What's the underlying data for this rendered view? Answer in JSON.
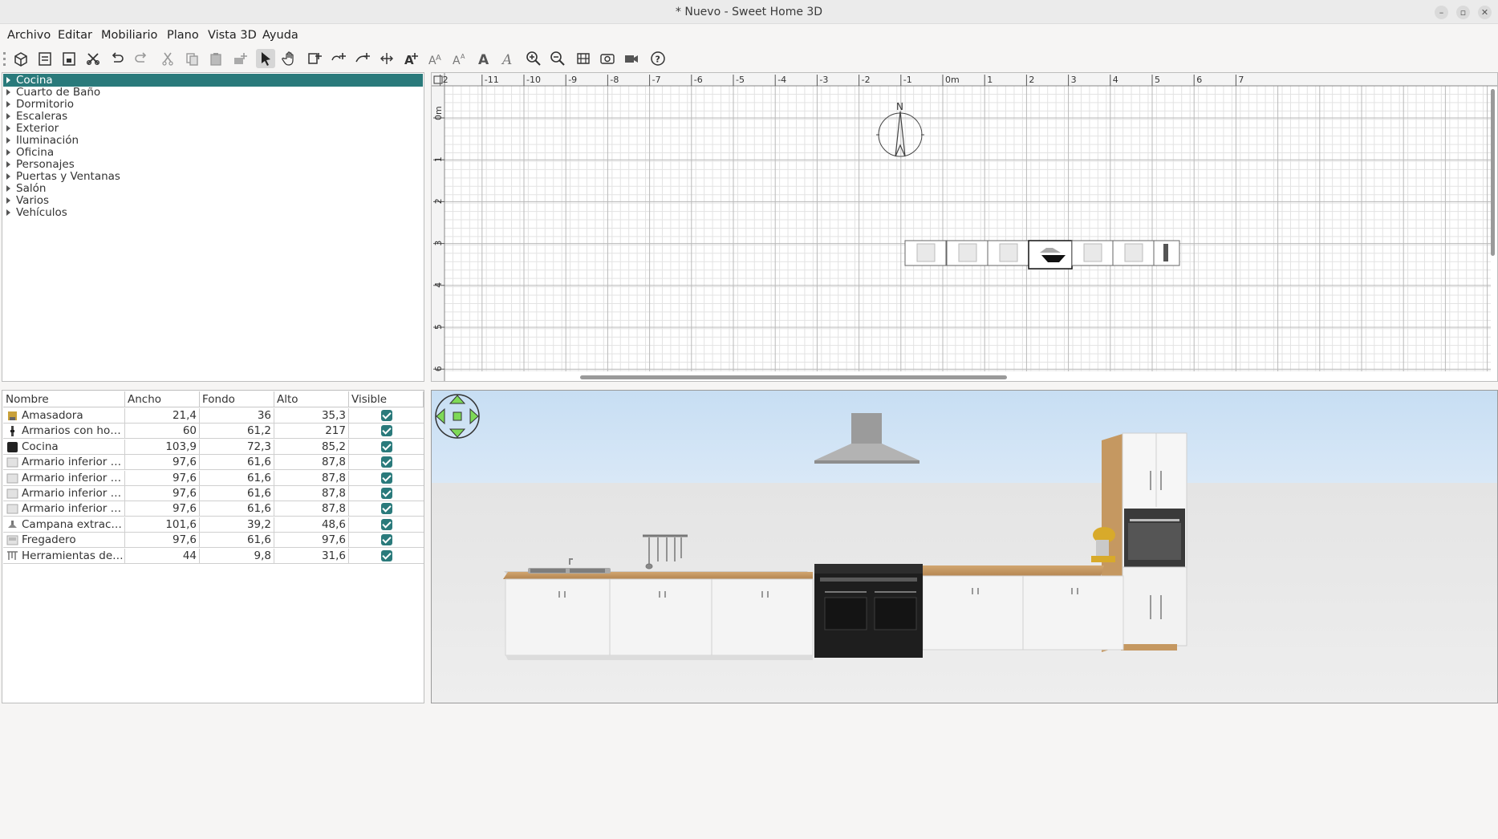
{
  "window": {
    "title": "* Nuevo - Sweet Home 3D",
    "controls": [
      "minimize-icon",
      "maximize-icon",
      "close-icon"
    ]
  },
  "menubar": {
    "items": [
      "Archivo",
      "Editar",
      "Mobiliario",
      "Plano",
      "Vista 3D",
      "Ayuda"
    ]
  },
  "toolbar": {
    "buttons": [
      "new-home-icon",
      "open-icon",
      "save-icon",
      "cut-wall-icon",
      "undo-icon",
      "redo-icon",
      "cut-icon",
      "copy-icon",
      "paste-icon",
      "add-furniture-icon",
      "select-mode-icon",
      "pan-mode-icon",
      "create-rooms-icon",
      "create-polylines-icon",
      "create-dimensions-icon",
      "create-walls-icon",
      "add-text-icon",
      "increase-text-size-icon",
      "decrease-text-size-icon",
      "bold-icon",
      "italic-icon",
      "zoom-in-icon",
      "zoom-out-icon",
      "create-photo-icon",
      "create-video-icon",
      "help-icon"
    ],
    "active": "select-mode-icon"
  },
  "catalog": {
    "categories": [
      "Cocina",
      "Cuarto de Baño",
      "Dormitorio",
      "Escaleras",
      "Exterior",
      "Iluminación",
      "Oficina",
      "Personajes",
      "Puertas y Ventanas",
      "Salón",
      "Varios",
      "Vehículos"
    ],
    "selected": "Cocina"
  },
  "furniture_table": {
    "columns": [
      "Nombre",
      "Ancho",
      "Fondo",
      "Alto",
      "Visible"
    ],
    "rows": [
      {
        "name": "Amasadora",
        "width": "21,4",
        "depth": "36",
        "height": "35,3",
        "visible": true,
        "icon": "mixer-icon"
      },
      {
        "name": "Armarios con horno i...",
        "width": "60",
        "depth": "61,2",
        "height": "217",
        "visible": true,
        "icon": "oven-cabinet-icon"
      },
      {
        "name": "Cocina",
        "width": "103,9",
        "depth": "72,3",
        "height": "85,2",
        "visible": true,
        "icon": "cooker-icon"
      },
      {
        "name": "Armario inferior dobe",
        "width": "97,6",
        "depth": "61,6",
        "height": "87,8",
        "visible": true,
        "icon": "cabinet-icon"
      },
      {
        "name": "Armario inferior dobe",
        "width": "97,6",
        "depth": "61,6",
        "height": "87,8",
        "visible": true,
        "icon": "cabinet-icon"
      },
      {
        "name": "Armario inferior dobe",
        "width": "97,6",
        "depth": "61,6",
        "height": "87,8",
        "visible": true,
        "icon": "cabinet-icon"
      },
      {
        "name": "Armario inferior dobe",
        "width": "97,6",
        "depth": "61,6",
        "height": "87,8",
        "visible": true,
        "icon": "cabinet-icon"
      },
      {
        "name": "Campana extractora",
        "width": "101,6",
        "depth": "39,2",
        "height": "48,6",
        "visible": true,
        "icon": "hood-icon"
      },
      {
        "name": "Fregadero",
        "width": "97,6",
        "depth": "61,6",
        "height": "97,6",
        "visible": true,
        "icon": "sink-icon"
      },
      {
        "name": "Herramientas de coc...",
        "width": "44",
        "depth": "9,8",
        "height": "31,6",
        "visible": true,
        "icon": "utensils-icon"
      }
    ]
  },
  "plan": {
    "ruler_x_labels": [
      "2",
      "-11",
      "-10",
      "-9",
      "-8",
      "-7",
      "-6",
      "-5",
      "-4",
      "-3",
      "-2",
      "-1",
      "0m",
      "1",
      "2",
      "3",
      "4",
      "5",
      "6",
      "7"
    ],
    "ruler_y_labels": [
      "0m",
      "1",
      "2",
      "3",
      "4",
      "5",
      "6"
    ],
    "compass_label": "N"
  },
  "colors": {
    "accent": "#2a7a7b",
    "sky": "#cfe3f5",
    "floor": "#e6e6e6",
    "countertop": "#c49a62",
    "cabinet": "#f3f3f3",
    "navigator": "#7ed957"
  }
}
